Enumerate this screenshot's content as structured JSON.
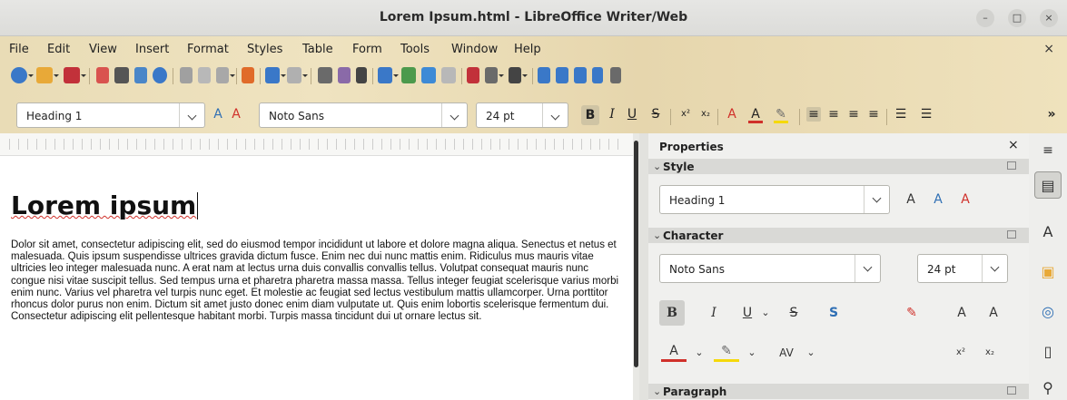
{
  "window": {
    "title": "Lorem Ipsum.html - LibreOffice Writer/Web",
    "minimize": "–",
    "maximize": "□",
    "close": "×"
  },
  "menu": {
    "items": [
      "File",
      "Edit",
      "View",
      "Insert",
      "Format",
      "Styles",
      "Table",
      "Form",
      "Tools",
      "Window",
      "Help"
    ],
    "close": "×"
  },
  "formatting_toolbar": {
    "paragraph_style": "Heading 1",
    "font_name": "Noto Sans",
    "font_size": "24 pt",
    "bold": "B",
    "italic": "I",
    "underline": "U",
    "strikethrough": "S",
    "superscript": "x²",
    "subscript": "x₂",
    "font_color": "A",
    "overflow": "»"
  },
  "document": {
    "heading": "Lorem ipsum",
    "paragraph": "Dolor sit amet, consectetur adipiscing elit, sed do eiusmod tempor incididunt ut labore et dolore magna aliqua. Senectus et netus et malesuada. Quis ipsum suspendisse ultrices gravida dictum fusce. Enim nec dui nunc mattis enim. Ridiculus mus mauris vitae ultricies leo integer malesuada nunc. A erat nam at lectus urna duis convallis convallis tellus. Volutpat consequat mauris nunc congue nisi vitae suscipit tellus. Sed tempus urna et pharetra pharetra massa massa. Tellus integer feugiat scelerisque varius morbi enim nunc. Varius vel pharetra vel turpis nunc eget. Et molestie ac feugiat sed lectus vestibulum mattis ullamcorper. Urna porttitor rhoncus dolor purus non enim. Dictum sit amet justo donec enim diam vulputate ut. Quis enim lobortis scelerisque fermentum dui. Consectetur adipiscing elit pellentesque habitant morbi. Turpis massa tincidunt dui ut ornare lectus sit."
  },
  "sidebar": {
    "title": "Properties",
    "close": "×",
    "menu": "≡",
    "style_section": "Style",
    "style_value": "Heading 1",
    "character_section": "Character",
    "font_name": "Noto Sans",
    "font_size": "24 pt",
    "bold": "B",
    "italic": "I",
    "underline": "U",
    "strike": "S",
    "shadow": "S",
    "grow": "A",
    "shrink": "A",
    "font_color": "A",
    "superscript": "x²",
    "subscript": "x₂",
    "paragraph_section": "Paragraph"
  },
  "colors": {
    "toolbar_theme": "#ecdfb9",
    "highlight_yellow": "#f5d90a",
    "font_red": "#d0302a",
    "accent_blue": "#2f6fb4"
  }
}
